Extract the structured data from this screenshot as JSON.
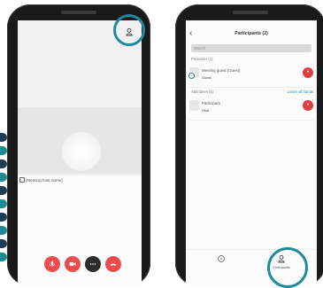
{
  "left_phone": {
    "meeting_label": "[Meeting host name]",
    "controls": [
      {
        "name": "mic",
        "color": "#ea4d4d",
        "icon": "microphone-icon"
      },
      {
        "name": "video",
        "color": "#ea4d4d",
        "icon": "video-icon"
      },
      {
        "name": "more",
        "color": "#2d2d2d",
        "icon": "more-icon"
      },
      {
        "name": "leave",
        "color": "#ea4d4d",
        "icon": "hang-up-icon"
      }
    ],
    "top_icon": "person-icon"
  },
  "right_phone": {
    "title": "Participants (2)",
    "back_icon": "back-chevron-icon",
    "search_placeholder": "Search",
    "sections": [
      {
        "label": "Presenter (1)",
        "link": "",
        "participants": [
          {
            "name": "Meeting guest (Guest)",
            "sub": "Guest"
          }
        ]
      },
      {
        "label": "Attendees (1)",
        "link": "Lower all hands",
        "participants": [
          {
            "name": "Participant",
            "sub": "Host"
          }
        ]
      }
    ],
    "tab_bar": [
      {
        "label": "",
        "icon": "chat-icon"
      },
      {
        "label": "Participants",
        "icon": "person-icon"
      }
    ]
  },
  "colors": {
    "accent": "#1f8aa0",
    "danger": "#e23c3c",
    "phone_frame": "#1a1a1a"
  }
}
